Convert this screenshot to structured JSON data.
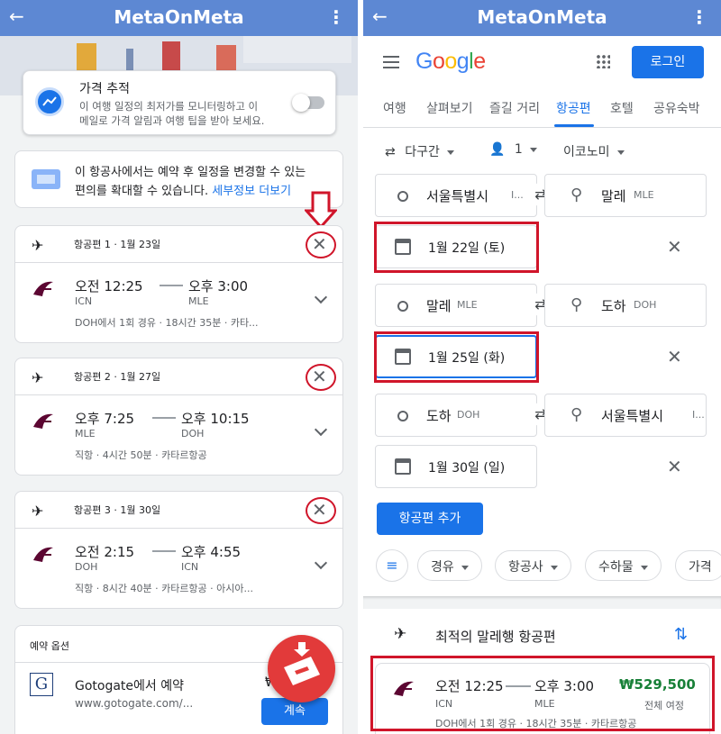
{
  "app": {
    "title": "MetaOnMeta"
  },
  "left": {
    "tracking": {
      "title": "가격 추적",
      "desc1": "이 여행 일정의 최저가를 모니터링하고 이",
      "desc2": "메일로 가격 알림과 여행 팁을 받아 보세요."
    },
    "notice": {
      "line1": "이 항공사에서는 예약 후 일정을 변경할 수 있는",
      "line2": "편의를 확대할 수 있습니다.",
      "link": "세부정보 더보기"
    },
    "legs": [
      {
        "header": "항공편 1 · 1월 23일",
        "dep": "오전 12:25",
        "arr": "오후 3:00",
        "from": "ICN",
        "to": "MLE",
        "info": "DOH에서 1회 경유 · 18시간 35분 · 카타..."
      },
      {
        "header": "항공편 2 · 1월 27일",
        "dep": "오후 7:25",
        "arr": "오후 10:15",
        "from": "MLE",
        "to": "DOH",
        "info": "직항 · 4시간 50분 · 카타르항공"
      },
      {
        "header": "항공편 3 · 1월 30일",
        "dep": "오전 2:15",
        "arr": "오후 4:55",
        "from": "DOH",
        "to": "ICN",
        "info": "직항 · 8시간 40분 · 카타르항공 · 아시아..."
      }
    ],
    "booking": {
      "section": "예약 옵션",
      "name": "Gotogate에서 예약",
      "url": "www.gotogate.com/...",
      "button": "계속",
      "price_partial": "₩"
    }
  },
  "right": {
    "google": {
      "logo": "Google",
      "login": "로그인"
    },
    "tabs": [
      "여행",
      "살펴보기",
      "즐길 거리",
      "항공편",
      "호텔",
      "공유숙박"
    ],
    "options": {
      "trip": "다구간",
      "passengers": "1",
      "cabin": "이코노미"
    },
    "legs": [
      {
        "from": "서울특별시",
        "from_code": "I...",
        "to": "말레",
        "to_code": "MLE",
        "date": "1월 22일 (토)"
      },
      {
        "from": "말레",
        "from_code": "MLE",
        "to": "도하",
        "to_code": "DOH",
        "date": "1월 25일 (화)"
      },
      {
        "from": "도하",
        "from_code": "DOH",
        "to": "서울특별시",
        "to_code": "I...",
        "date": "1월 30일 (일)"
      }
    ],
    "add_flight": "항공편 추가",
    "filters": [
      "경유",
      "항공사",
      "수하물",
      "가격"
    ],
    "best": {
      "title": "최적의 말레행 항공편",
      "dep": "오전 12:25",
      "arr": "오후 3:00",
      "from": "ICN",
      "to": "MLE",
      "price": "₩529,500",
      "price_note": "전체 여정",
      "info": "DOH에서 1회 경유 · 18시간 35분 · 카타르항공"
    }
  }
}
